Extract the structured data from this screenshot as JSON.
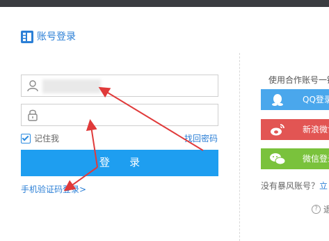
{
  "header": {
    "title": "账号登录",
    "icon": "grid-login-icon"
  },
  "form": {
    "username": {
      "value": ""
    },
    "password": {
      "value": ""
    },
    "remember_label": "记住我",
    "remember_checked": true,
    "forgot_label": "找回密码",
    "login_label": "登 录",
    "sms_login_label": "手机验证码登录>"
  },
  "partner": {
    "title": "使用合作账号一键",
    "buttons": [
      {
        "label": "QQ登录",
        "icon": "qq-icon",
        "color": "#4aa7ec"
      },
      {
        "label": "新浪微博登",
        "icon": "weibo-icon",
        "color": "#e25553"
      },
      {
        "label": "微信登录",
        "icon": "wechat-icon",
        "color": "#7ac23c"
      }
    ],
    "no_account_prefix": "没有暴风账号？",
    "register_label": "立",
    "help_label": "退"
  },
  "colors": {
    "primary": "#1e9ef0",
    "link": "#2b7fd6",
    "annotation": "#e03a3a"
  }
}
